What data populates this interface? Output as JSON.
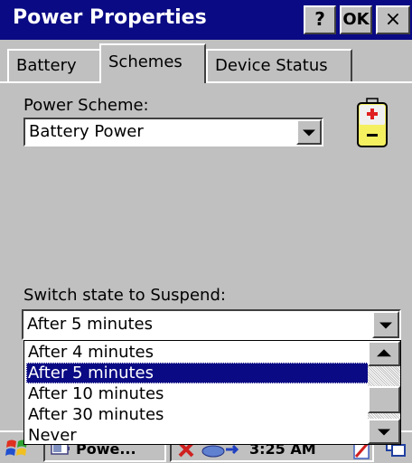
{
  "window": {
    "title": "Power Properties",
    "help_label": "?",
    "ok_label": "OK",
    "close_label": "×"
  },
  "tabs": [
    {
      "label": "Battery"
    },
    {
      "label": "Schemes"
    },
    {
      "label": "Device Status"
    }
  ],
  "power_scheme": {
    "label": "Power Scheme:",
    "value": "Battery Power"
  },
  "suspend": {
    "label": "Switch state to Suspend:",
    "value": "After 5 minutes",
    "options": [
      "After 4 minutes",
      "After 5 minutes",
      "After 10 minutes",
      "After 30 minutes",
      "Never"
    ],
    "selected_index": 1
  },
  "taskbar": {
    "task_label": "Powe...",
    "clock": "3:25 AM"
  },
  "colors": {
    "titlebar": "#0a0a84",
    "face": "#c0c0c0",
    "selection": "#0a0a84"
  },
  "icons": {
    "battery": "battery-icon",
    "start": "windows-flag-icon",
    "task": "power-task-icon",
    "network": "network-disconnected-icon",
    "connectivity": "connection-arrow-icon",
    "input": "pen-input-icon",
    "desktop": "desktop-icon"
  }
}
